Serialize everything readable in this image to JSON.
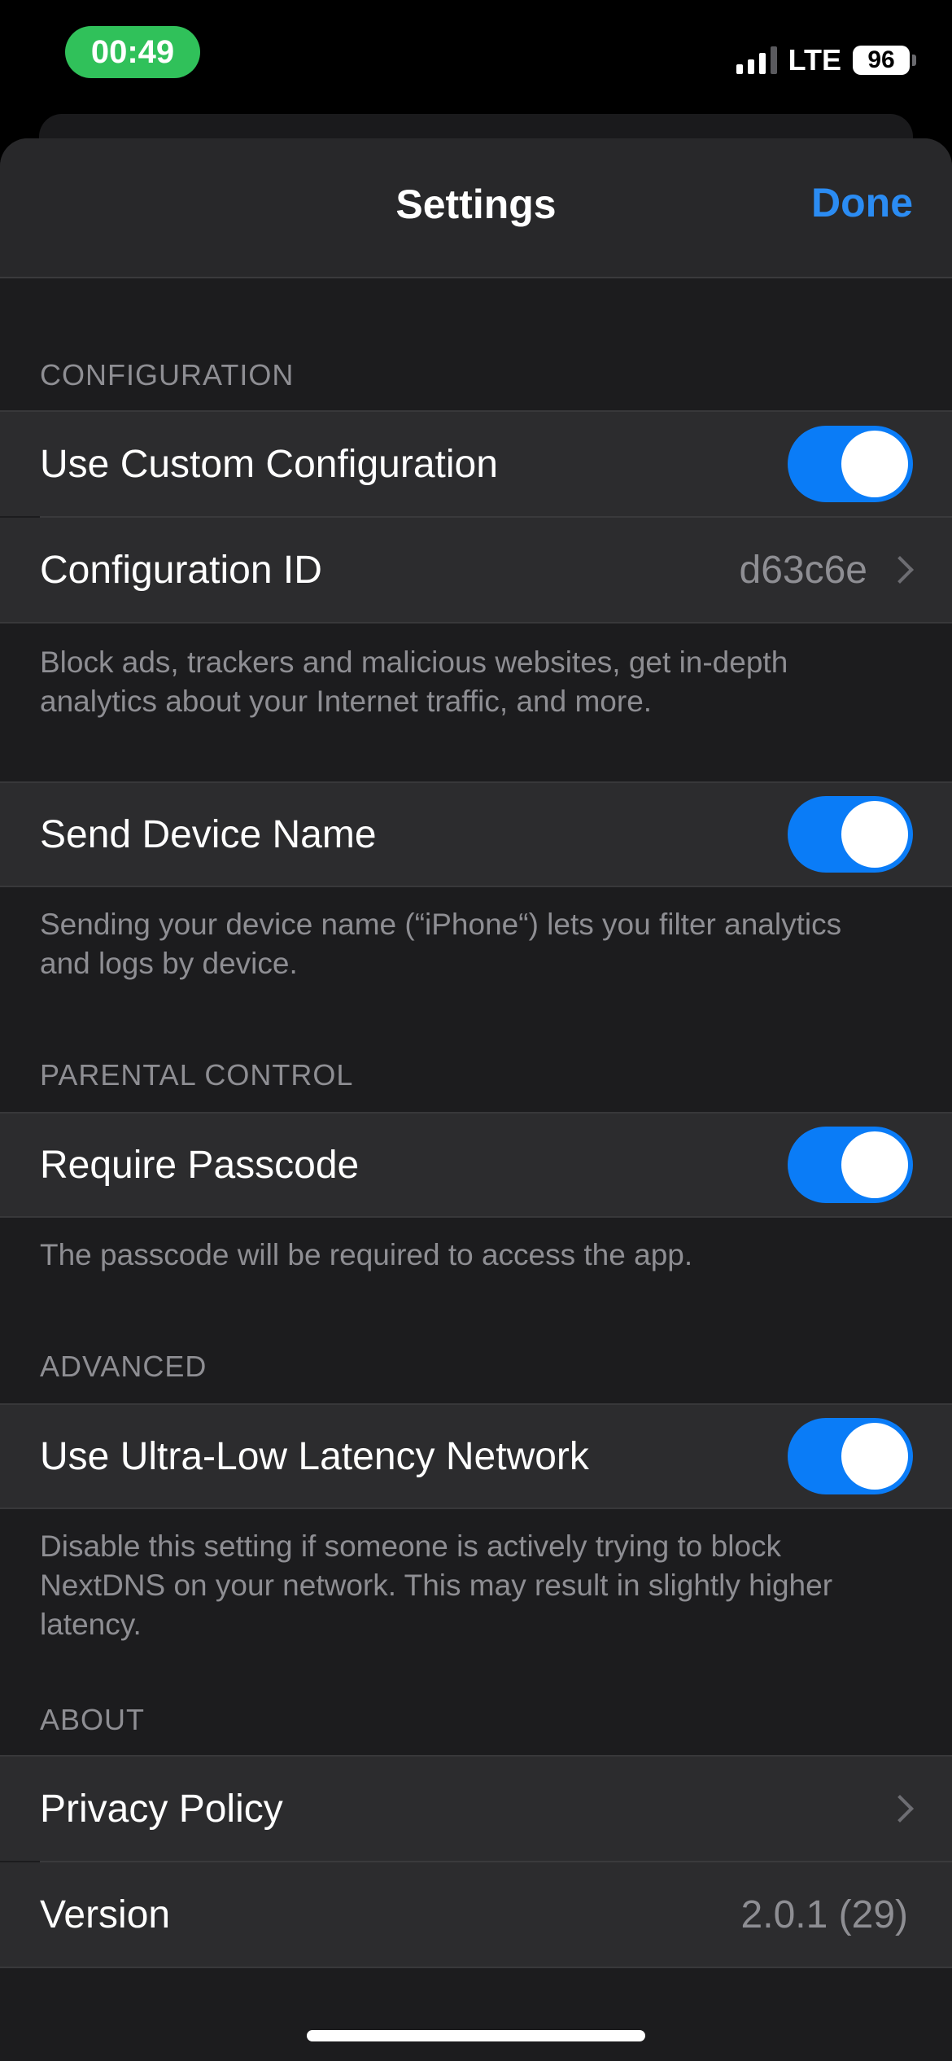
{
  "status_bar": {
    "time": "00:49",
    "network": "LTE",
    "battery": "96"
  },
  "nav": {
    "title": "Settings",
    "done_label": "Done"
  },
  "sections": {
    "configuration": {
      "header": "CONFIGURATION",
      "use_custom_label": "Use Custom Configuration",
      "use_custom_on": true,
      "config_id_label": "Configuration ID",
      "config_id_value": "d63c6e",
      "footer": "Block ads, trackers and malicious websites, get in-depth analytics about your Internet traffic, and more."
    },
    "device": {
      "send_name_label": "Send Device Name",
      "send_name_on": true,
      "footer": "Sending your device name (“iPhone“) lets you filter analytics and logs by device."
    },
    "parental": {
      "header": "PARENTAL CONTROL",
      "passcode_label": "Require Passcode",
      "passcode_on": true,
      "footer": "The passcode will be required to access the app."
    },
    "advanced": {
      "header": "ADVANCED",
      "ull_label": "Use Ultra-Low Latency Network",
      "ull_on": true,
      "footer": "Disable this setting if someone is actively trying to block NextDNS on your network. This may result in slightly higher latency."
    },
    "about": {
      "header": "ABOUT",
      "privacy_label": "Privacy Policy",
      "version_label": "Version",
      "version_value": "2.0.1 (29)"
    }
  },
  "colors": {
    "accent": "#0a7cf7",
    "link": "#2b8cf3",
    "time_pill": "#30c15a"
  }
}
